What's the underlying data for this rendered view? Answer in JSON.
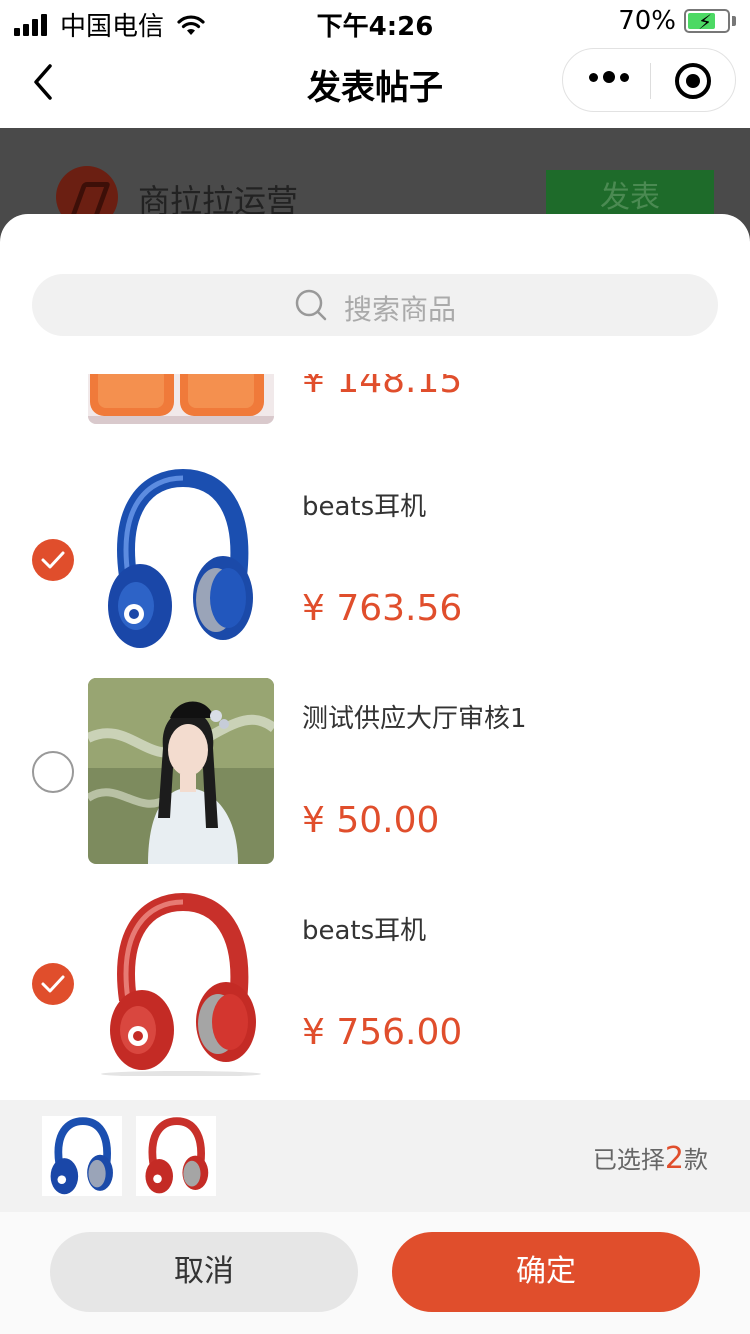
{
  "status_bar": {
    "carrier": "中国电信",
    "time": "下午4:26",
    "battery_percent": "70%",
    "battery_level": 0.7
  },
  "nav": {
    "title": "发表帖子"
  },
  "background_page": {
    "shop_name": "商拉拉运营",
    "publish_label": "发表"
  },
  "search": {
    "placeholder": "搜索商品"
  },
  "products": [
    {
      "name": "",
      "price": "¥ 148.15",
      "selected": null,
      "image": "orange-product"
    },
    {
      "name": "beats耳机",
      "price": "¥ 763.56",
      "selected": true,
      "image": "blue-headphones"
    },
    {
      "name": "测试供应大厅审核1",
      "price": "¥ 50.00",
      "selected": false,
      "image": "portrait-painting"
    },
    {
      "name": "beats耳机",
      "price": "¥ 756.00",
      "selected": true,
      "image": "red-headphones"
    }
  ],
  "selection": {
    "prefix": "已选择",
    "count": "2",
    "suffix": "款"
  },
  "buttons": {
    "cancel": "取消",
    "confirm": "确定"
  },
  "colors": {
    "accent": "#e04e2c",
    "check_off": "#999999",
    "search_bg": "#f1f1f1"
  }
}
